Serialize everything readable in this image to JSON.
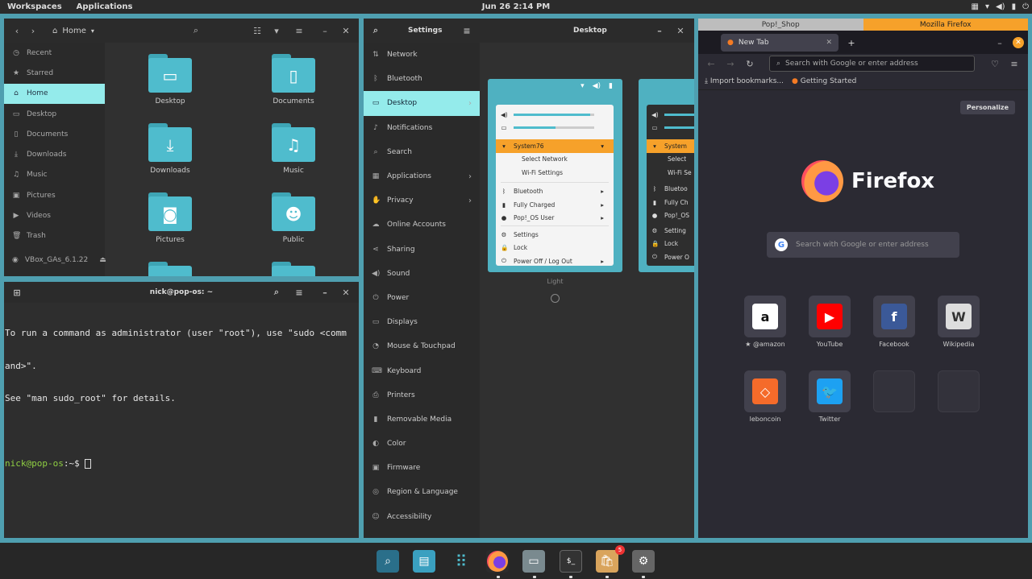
{
  "topbar": {
    "workspaces": "Workspaces",
    "applications": "Applications",
    "clock": "Jun 26  2:14 PM"
  },
  "files": {
    "path": "Home",
    "sidebar": [
      {
        "label": "Recent",
        "icon": "clock-icon"
      },
      {
        "label": "Starred",
        "icon": "star-icon"
      },
      {
        "label": "Home",
        "icon": "home-icon",
        "active": true
      },
      {
        "label": "Desktop",
        "icon": "folder-icon"
      },
      {
        "label": "Documents",
        "icon": "document-icon"
      },
      {
        "label": "Downloads",
        "icon": "download-icon"
      },
      {
        "label": "Music",
        "icon": "music-icon"
      },
      {
        "label": "Pictures",
        "icon": "image-icon"
      },
      {
        "label": "Videos",
        "icon": "video-icon"
      },
      {
        "label": "Trash",
        "icon": "trash-icon"
      },
      {
        "label": "VBox_GAs_6.1.22",
        "icon": "disc-icon"
      }
    ],
    "folders": [
      "Desktop",
      "Documents",
      "Downloads",
      "Music",
      "Pictures",
      "Public"
    ]
  },
  "terminal": {
    "title": "nick@pop-os: ~",
    "line1": "To run a command as administrator (user \"root\"), use \"sudo <comm",
    "line2": "and>\".",
    "line3": "See \"man sudo_root\" for details.",
    "prompt": "nick@pop-os",
    "prompt_suffix": ":~$ "
  },
  "settings": {
    "title": "Settings",
    "panel_title": "Desktop",
    "nav": [
      {
        "label": "Network",
        "icon": "network-icon"
      },
      {
        "label": "Bluetooth",
        "icon": "bluetooth-icon"
      },
      {
        "label": "Desktop",
        "icon": "desktop-icon",
        "active": true,
        "arrow": true
      },
      {
        "label": "Notifications",
        "icon": "bell-icon"
      },
      {
        "label": "Search",
        "icon": "search-icon"
      },
      {
        "label": "Applications",
        "icon": "apps-icon",
        "arrow": true
      },
      {
        "label": "Privacy",
        "icon": "hand-icon",
        "arrow": true
      },
      {
        "label": "Online Accounts",
        "icon": "cloud-icon"
      },
      {
        "label": "Sharing",
        "icon": "share-icon"
      },
      {
        "label": "Sound",
        "icon": "sound-icon"
      },
      {
        "label": "Power",
        "icon": "power-icon"
      },
      {
        "label": "Displays",
        "icon": "display-icon"
      },
      {
        "label": "Mouse & Touchpad",
        "icon": "mouse-icon"
      },
      {
        "label": "Keyboard",
        "icon": "keyboard-icon"
      },
      {
        "label": "Printers",
        "icon": "printer-icon"
      },
      {
        "label": "Removable Media",
        "icon": "usb-icon"
      },
      {
        "label": "Color",
        "icon": "color-icon"
      },
      {
        "label": "Firmware",
        "icon": "chip-icon"
      },
      {
        "label": "Region & Language",
        "icon": "globe-icon"
      },
      {
        "label": "Accessibility",
        "icon": "accessibility-icon"
      }
    ],
    "theme_menu": {
      "network": "System76",
      "select_network": "Select Network",
      "wifi_settings": "Wi-Fi Settings",
      "bluetooth": "Bluetooth",
      "charged": "Fully Charged",
      "user": "Pop!_OS User",
      "settings": "Settings",
      "lock": "Lock",
      "power": "Power Off / Log Out"
    },
    "theme_menu_dark_clipped": {
      "network": "System",
      "select_network": "Select",
      "wifi": "Wi-Fi Se",
      "bluetooth": "Bluetoo",
      "charged": "Fully Ch",
      "user": "Pop!_OS",
      "settings": "Setting",
      "lock": "Lock",
      "power": "Power O"
    },
    "light_label": "Light"
  },
  "firefox": {
    "window_tabs": [
      "Pop!_Shop",
      "Mozilla Firefox"
    ],
    "tab_title": "New Tab",
    "url_placeholder": "Search with Google or enter address",
    "bookmarks": [
      "Import bookmarks...",
      "Getting Started"
    ],
    "personalize": "Personalize",
    "brand": "Firefox",
    "search_placeholder": "Search with Google or enter address",
    "tiles": [
      {
        "label": "★ @amazon",
        "letter": "a",
        "color": "#ffffff",
        "fg": "#111111"
      },
      {
        "label": "YouTube",
        "letter": "▶",
        "color": "#ff0000",
        "fg": "#ffffff"
      },
      {
        "label": "Facebook",
        "letter": "f",
        "color": "#3b5998",
        "fg": "#ffffff"
      },
      {
        "label": "Wikipedia",
        "letter": "W",
        "color": "#dddddd",
        "fg": "#333333"
      },
      {
        "label": "leboncoin",
        "letter": "◇",
        "color": "#f56b2a",
        "fg": "#ffffff"
      },
      {
        "label": "Twitter",
        "letter": "🐦",
        "color": "#1da1f2",
        "fg": "#ffffff"
      }
    ]
  },
  "dock": {
    "badge": "5"
  },
  "colors": {
    "accent": "#94ebeb",
    "folder": "#4fbccd",
    "orange": "#f6a12a",
    "prompt": "#8fcf43"
  }
}
